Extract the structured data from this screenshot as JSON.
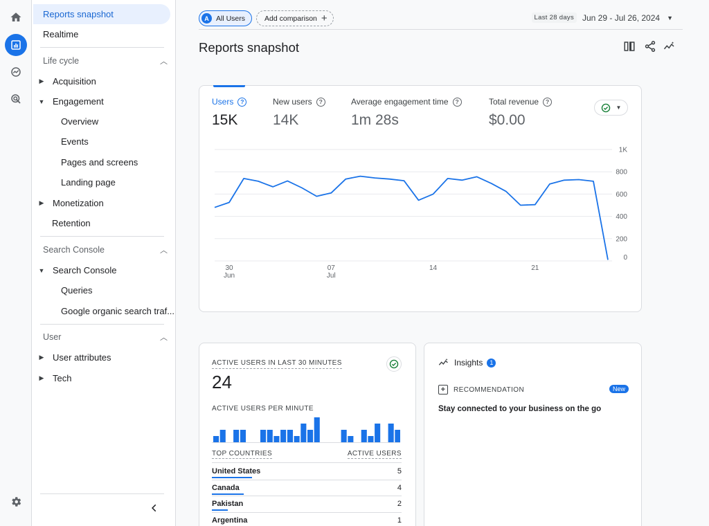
{
  "sidebar": {
    "selected_item": "Reports snapshot",
    "realtime": "Realtime",
    "sections": [
      {
        "label": "Life cycle",
        "items": [
          "Acquisition",
          "Engagement",
          "Overview",
          "Events",
          "Pages and screens",
          "Landing page",
          "Monetization",
          "Retention"
        ]
      },
      {
        "label": "Search Console",
        "items": [
          "Search Console",
          "Queries",
          "Google organic search traf..."
        ]
      },
      {
        "label": "User",
        "items": [
          "User attributes",
          "Tech"
        ]
      }
    ]
  },
  "toolbar": {
    "all_users": "All Users",
    "all_users_badge": "A",
    "add_comparison": "Add comparison",
    "date_pill": "Last 28 days",
    "date_range": "Jun 29 - Jul 26, 2024"
  },
  "page_title": "Reports snapshot",
  "metrics": [
    {
      "label": "Users",
      "value": "15K"
    },
    {
      "label": "New users",
      "value": "14K"
    },
    {
      "label": "Average engagement time",
      "value": "1m 28s"
    },
    {
      "label": "Total revenue",
      "value": "$0.00"
    }
  ],
  "chart_data": {
    "type": "line",
    "series": [
      {
        "values": [
          480,
          525,
          740,
          715,
          665,
          718,
          655,
          580,
          610,
          735,
          760,
          745,
          735,
          720,
          545,
          600,
          740,
          725,
          755,
          695,
          625,
          500,
          505,
          690,
          725,
          730,
          715,
          10
        ]
      }
    ],
    "x_tick_labels": [
      {
        "day": "30",
        "month": "Jun",
        "index": 1
      },
      {
        "day": "07",
        "month": "Jul",
        "index": 8
      },
      {
        "day": "14",
        "month": "",
        "index": 15
      },
      {
        "day": "21",
        "month": "",
        "index": 22
      }
    ],
    "y_tick_labels": [
      "1K",
      "800",
      "600",
      "400",
      "200",
      "0"
    ],
    "y_ticks": [
      1000,
      800,
      600,
      400,
      200,
      0
    ],
    "ylim": [
      0,
      1000
    ],
    "grid": true,
    "color": "#1a73e8"
  },
  "realtime": {
    "title": "ACTIVE USERS IN LAST 30 MINUTES",
    "value": "24",
    "per_minute_label": "ACTIVE USERS PER MINUTE",
    "per_minute": [
      1,
      2,
      0,
      2,
      2,
      0,
      0,
      2,
      2,
      1,
      2,
      2,
      1,
      3,
      2,
      4,
      0,
      0,
      0,
      2,
      1,
      0,
      2,
      1,
      3,
      0,
      3,
      2
    ],
    "col_country": "TOP COUNTRIES",
    "col_users": "ACTIVE USERS",
    "countries": [
      {
        "name": "United States",
        "value": "5",
        "share": 1.0
      },
      {
        "name": "Canada",
        "value": "4",
        "share": 0.8
      },
      {
        "name": "Pakistan",
        "value": "2",
        "share": 0.4
      },
      {
        "name": "Argentina",
        "value": "1",
        "share": 0.2
      }
    ]
  },
  "insights": {
    "title": "Insights",
    "count": "1",
    "recommendation_label": "RECOMMENDATION",
    "new_badge": "New",
    "recommendation_text": "Stay connected to your business on the go"
  },
  "colors": {
    "accent": "#1a73e8",
    "selected_bg": "#e8f0fe",
    "check_green": "#188038"
  }
}
